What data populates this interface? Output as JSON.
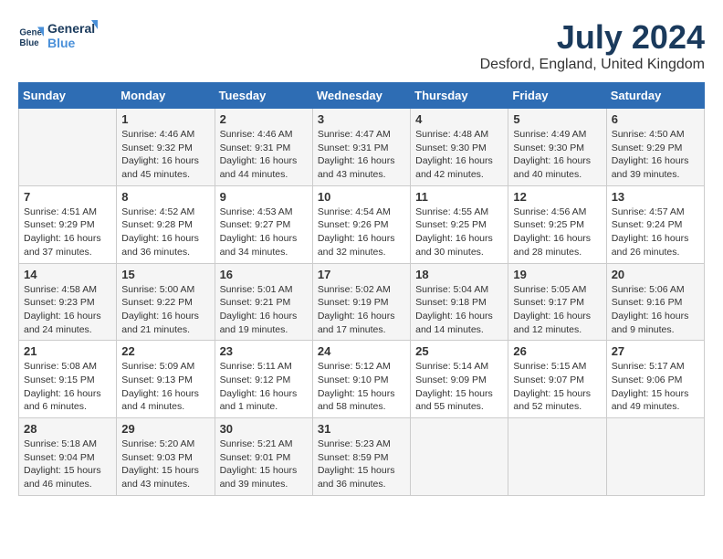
{
  "header": {
    "logo_line1": "General",
    "logo_line2": "Blue",
    "month_year": "July 2024",
    "location": "Desford, England, United Kingdom"
  },
  "days_of_week": [
    "Sunday",
    "Monday",
    "Tuesday",
    "Wednesday",
    "Thursday",
    "Friday",
    "Saturday"
  ],
  "weeks": [
    [
      {
        "day": "",
        "info": ""
      },
      {
        "day": "1",
        "info": "Sunrise: 4:46 AM\nSunset: 9:32 PM\nDaylight: 16 hours\nand 45 minutes."
      },
      {
        "day": "2",
        "info": "Sunrise: 4:46 AM\nSunset: 9:31 PM\nDaylight: 16 hours\nand 44 minutes."
      },
      {
        "day": "3",
        "info": "Sunrise: 4:47 AM\nSunset: 9:31 PM\nDaylight: 16 hours\nand 43 minutes."
      },
      {
        "day": "4",
        "info": "Sunrise: 4:48 AM\nSunset: 9:30 PM\nDaylight: 16 hours\nand 42 minutes."
      },
      {
        "day": "5",
        "info": "Sunrise: 4:49 AM\nSunset: 9:30 PM\nDaylight: 16 hours\nand 40 minutes."
      },
      {
        "day": "6",
        "info": "Sunrise: 4:50 AM\nSunset: 9:29 PM\nDaylight: 16 hours\nand 39 minutes."
      }
    ],
    [
      {
        "day": "7",
        "info": "Sunrise: 4:51 AM\nSunset: 9:29 PM\nDaylight: 16 hours\nand 37 minutes."
      },
      {
        "day": "8",
        "info": "Sunrise: 4:52 AM\nSunset: 9:28 PM\nDaylight: 16 hours\nand 36 minutes."
      },
      {
        "day": "9",
        "info": "Sunrise: 4:53 AM\nSunset: 9:27 PM\nDaylight: 16 hours\nand 34 minutes."
      },
      {
        "day": "10",
        "info": "Sunrise: 4:54 AM\nSunset: 9:26 PM\nDaylight: 16 hours\nand 32 minutes."
      },
      {
        "day": "11",
        "info": "Sunrise: 4:55 AM\nSunset: 9:25 PM\nDaylight: 16 hours\nand 30 minutes."
      },
      {
        "day": "12",
        "info": "Sunrise: 4:56 AM\nSunset: 9:25 PM\nDaylight: 16 hours\nand 28 minutes."
      },
      {
        "day": "13",
        "info": "Sunrise: 4:57 AM\nSunset: 9:24 PM\nDaylight: 16 hours\nand 26 minutes."
      }
    ],
    [
      {
        "day": "14",
        "info": "Sunrise: 4:58 AM\nSunset: 9:23 PM\nDaylight: 16 hours\nand 24 minutes."
      },
      {
        "day": "15",
        "info": "Sunrise: 5:00 AM\nSunset: 9:22 PM\nDaylight: 16 hours\nand 21 minutes."
      },
      {
        "day": "16",
        "info": "Sunrise: 5:01 AM\nSunset: 9:21 PM\nDaylight: 16 hours\nand 19 minutes."
      },
      {
        "day": "17",
        "info": "Sunrise: 5:02 AM\nSunset: 9:19 PM\nDaylight: 16 hours\nand 17 minutes."
      },
      {
        "day": "18",
        "info": "Sunrise: 5:04 AM\nSunset: 9:18 PM\nDaylight: 16 hours\nand 14 minutes."
      },
      {
        "day": "19",
        "info": "Sunrise: 5:05 AM\nSunset: 9:17 PM\nDaylight: 16 hours\nand 12 minutes."
      },
      {
        "day": "20",
        "info": "Sunrise: 5:06 AM\nSunset: 9:16 PM\nDaylight: 16 hours\nand 9 minutes."
      }
    ],
    [
      {
        "day": "21",
        "info": "Sunrise: 5:08 AM\nSunset: 9:15 PM\nDaylight: 16 hours\nand 6 minutes."
      },
      {
        "day": "22",
        "info": "Sunrise: 5:09 AM\nSunset: 9:13 PM\nDaylight: 16 hours\nand 4 minutes."
      },
      {
        "day": "23",
        "info": "Sunrise: 5:11 AM\nSunset: 9:12 PM\nDaylight: 16 hours\nand 1 minute."
      },
      {
        "day": "24",
        "info": "Sunrise: 5:12 AM\nSunset: 9:10 PM\nDaylight: 15 hours\nand 58 minutes."
      },
      {
        "day": "25",
        "info": "Sunrise: 5:14 AM\nSunset: 9:09 PM\nDaylight: 15 hours\nand 55 minutes."
      },
      {
        "day": "26",
        "info": "Sunrise: 5:15 AM\nSunset: 9:07 PM\nDaylight: 15 hours\nand 52 minutes."
      },
      {
        "day": "27",
        "info": "Sunrise: 5:17 AM\nSunset: 9:06 PM\nDaylight: 15 hours\nand 49 minutes."
      }
    ],
    [
      {
        "day": "28",
        "info": "Sunrise: 5:18 AM\nSunset: 9:04 PM\nDaylight: 15 hours\nand 46 minutes."
      },
      {
        "day": "29",
        "info": "Sunrise: 5:20 AM\nSunset: 9:03 PM\nDaylight: 15 hours\nand 43 minutes."
      },
      {
        "day": "30",
        "info": "Sunrise: 5:21 AM\nSunset: 9:01 PM\nDaylight: 15 hours\nand 39 minutes."
      },
      {
        "day": "31",
        "info": "Sunrise: 5:23 AM\nSunset: 8:59 PM\nDaylight: 15 hours\nand 36 minutes."
      },
      {
        "day": "",
        "info": ""
      },
      {
        "day": "",
        "info": ""
      },
      {
        "day": "",
        "info": ""
      }
    ]
  ]
}
